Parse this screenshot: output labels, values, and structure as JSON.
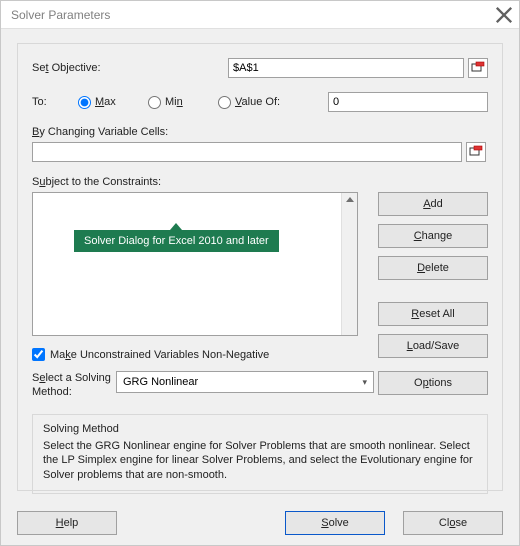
{
  "window": {
    "title": "Solver Parameters"
  },
  "objective": {
    "label": "Set Objective:",
    "value": "$A$1"
  },
  "to": {
    "label": "To:",
    "max": "Max",
    "min": "Min",
    "valueof": "Value Of:",
    "selected": "max",
    "valueof_value": "0"
  },
  "changing": {
    "label": "By Changing Variable Cells:",
    "value": ""
  },
  "constraints": {
    "label": "Subject to the Constraints:",
    "items": []
  },
  "side_buttons": {
    "add": "Add",
    "change": "Change",
    "delete": "Delete",
    "reset": "Reset All",
    "loadsave": "Load/Save"
  },
  "unconstrained": {
    "label": "Make Unconstrained Variables Non-Negative",
    "checked": true
  },
  "method": {
    "label": "Select a Solving Method:",
    "value": "GRG Nonlinear",
    "options_btn": "Options"
  },
  "info": {
    "title": "Solving Method",
    "text": "Select the GRG Nonlinear engine for Solver Problems that are smooth nonlinear. Select the LP Simplex engine for linear Solver Problems, and select the Evolutionary engine for Solver problems that are non-smooth."
  },
  "bottom": {
    "help": "Help",
    "solve": "Solve",
    "close": "Close"
  },
  "callout": {
    "text": "Solver Dialog for Excel 2010 and later"
  }
}
